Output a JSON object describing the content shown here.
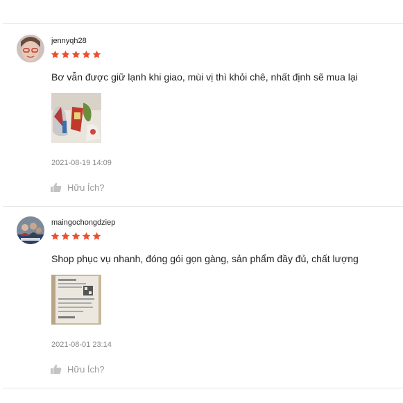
{
  "reviews": [
    {
      "username": "jennyqh28",
      "rating": 5,
      "comment": "Bơ vẫn được giữ lạnh khi giao, mùi vị thì khỏi chê, nhất định sẽ mua lại",
      "timestamp": "2021-08-19 14:09",
      "helpful_label": "Hữu Ích?"
    },
    {
      "username": "maingochongdziep",
      "rating": 5,
      "comment": "Shop phục vụ nhanh, đóng gói gọn gàng, sản phẩm đầy đủ, chất lượng",
      "timestamp": "2021-08-01 23:14",
      "helpful_label": "Hữu Ích?"
    }
  ],
  "colors": {
    "star": "#ee4d2d",
    "helpful_text": "#9a9a9a",
    "divider": "#e6e6e6"
  },
  "icons": {
    "star": "star-icon",
    "like": "thumbs-up-icon"
  }
}
